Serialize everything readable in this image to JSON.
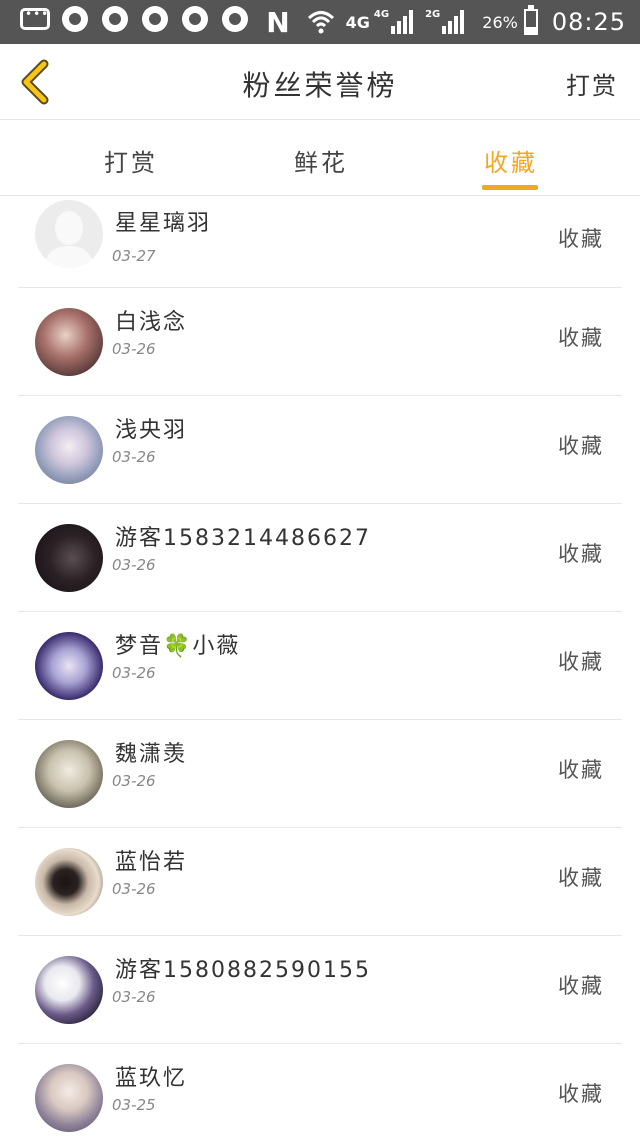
{
  "status_bar": {
    "network_n": "N",
    "network_4g": "4G",
    "sim1_label": "4G",
    "sim2_label": "2G",
    "battery": "26%",
    "time": "08:25"
  },
  "header": {
    "title": "粉丝荣誉榜",
    "action": "打赏",
    "back_icon": "chevron-left-icon",
    "accent_color": "#f5a623"
  },
  "tabs": [
    {
      "label": "打赏",
      "active": false
    },
    {
      "label": "鲜花",
      "active": false
    },
    {
      "label": "收藏",
      "active": true
    }
  ],
  "fans": [
    {
      "name": "星星璃羽",
      "date": "03-27",
      "action": "收藏"
    },
    {
      "name": "白浅念",
      "date": "03-26",
      "action": "收藏"
    },
    {
      "name": "浅央羽",
      "date": "03-26",
      "action": "收藏"
    },
    {
      "name": "游客1583214486627",
      "date": "03-26",
      "action": "收藏"
    },
    {
      "name": "梦音🍀小薇",
      "date": "03-26",
      "action": "收藏"
    },
    {
      "name": "魏潇羡",
      "date": "03-26",
      "action": "收藏"
    },
    {
      "name": "蓝怡若",
      "date": "03-26",
      "action": "收藏"
    },
    {
      "name": "游客1580882590155",
      "date": "03-26",
      "action": "收藏"
    },
    {
      "name": "蓝玖忆",
      "date": "03-25",
      "action": "收藏"
    }
  ]
}
